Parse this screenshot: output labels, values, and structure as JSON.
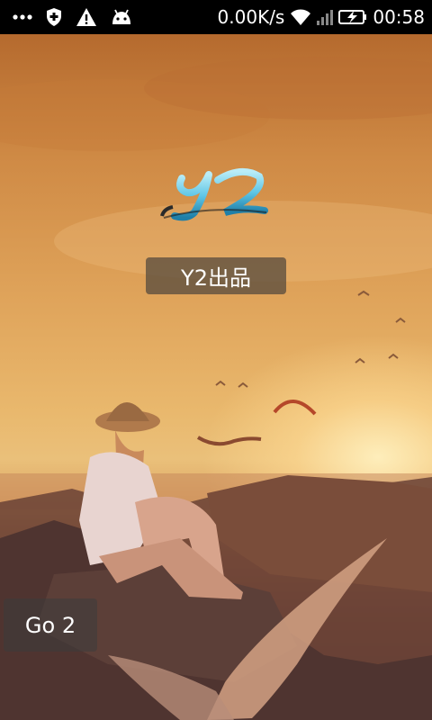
{
  "status_bar": {
    "network_speed": "0.00K/s",
    "time": "00:58",
    "icons": [
      "more-icon",
      "shield-icon",
      "warning-icon",
      "android-icon",
      "wifi-icon",
      "signal-icon",
      "battery-charging-icon"
    ]
  },
  "splash": {
    "logo_text": "Y2",
    "brand_label": "Y2出品",
    "go_button_label": "Go 2"
  },
  "colors": {
    "status_bar_bg": "#000000",
    "badge_bg": "#50463c",
    "logo_blue": "#5fc6e6"
  }
}
